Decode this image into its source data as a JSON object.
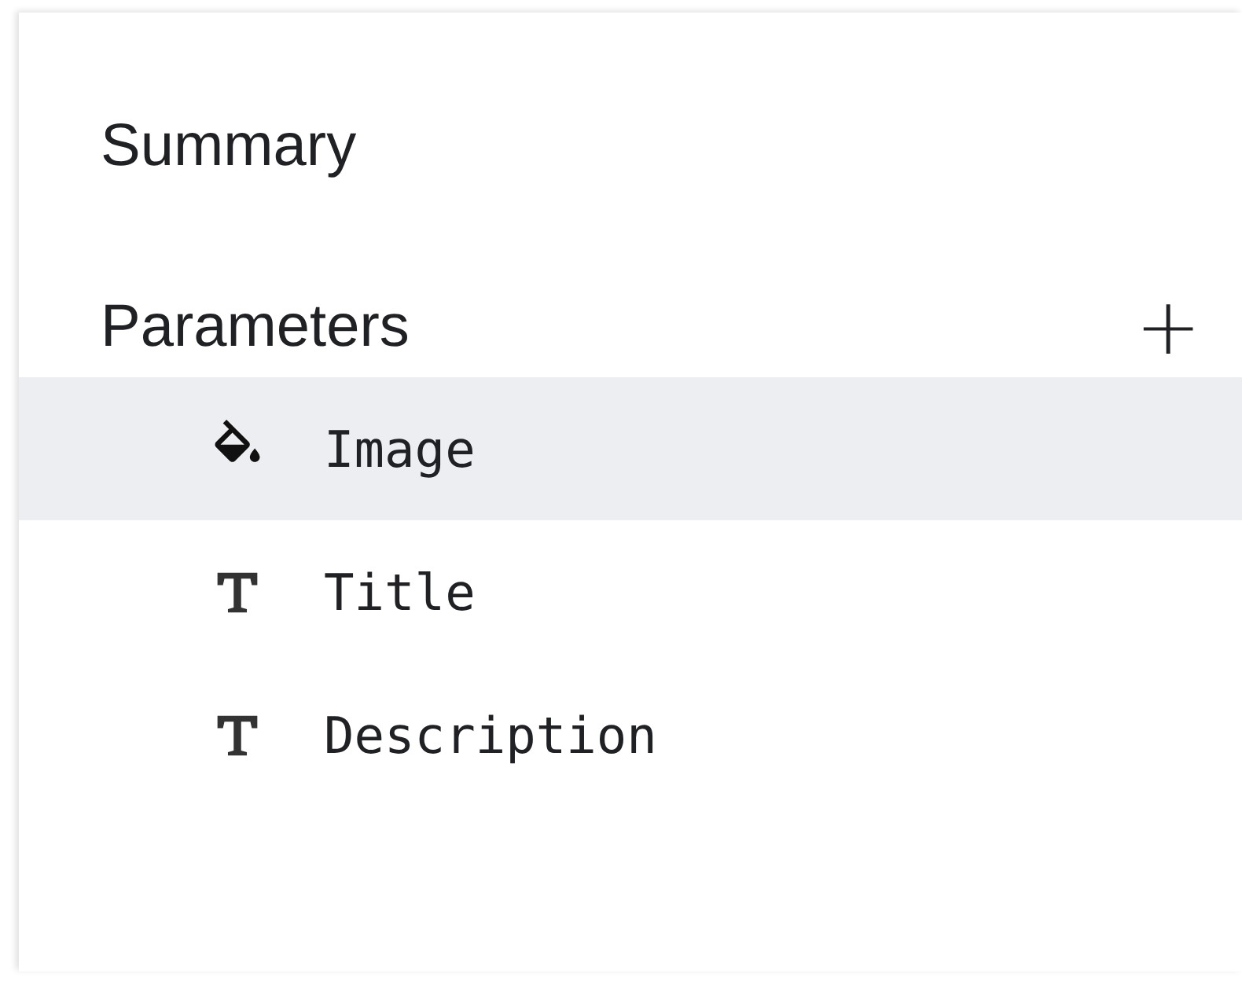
{
  "summary": {
    "label": "Summary"
  },
  "parameters": {
    "label": "Parameters",
    "add_button": "+",
    "items": [
      {
        "label": "Image",
        "kind": "paint",
        "selected": true
      },
      {
        "label": "Title",
        "kind": "text",
        "selected": false
      },
      {
        "label": "Description",
        "kind": "text",
        "selected": false
      }
    ]
  }
}
